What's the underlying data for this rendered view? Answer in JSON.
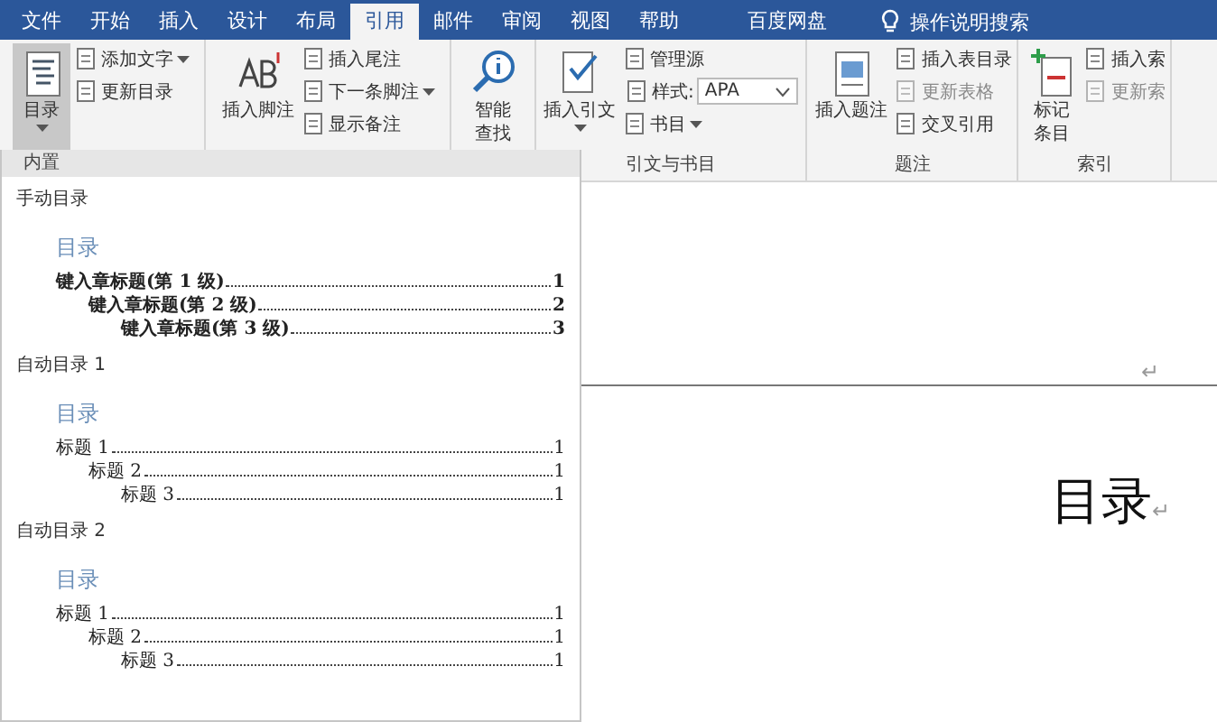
{
  "menu_tabs": [
    {
      "label": "文件",
      "selected": false
    },
    {
      "label": "开始",
      "selected": false
    },
    {
      "label": "插入",
      "selected": false
    },
    {
      "label": "设计",
      "selected": false
    },
    {
      "label": "布局",
      "selected": false
    },
    {
      "label": "引用",
      "selected": true
    },
    {
      "label": "邮件",
      "selected": false
    },
    {
      "label": "审阅",
      "selected": false
    },
    {
      "label": "视图",
      "selected": false
    },
    {
      "label": "帮助",
      "selected": false
    },
    {
      "label": "百度网盘",
      "selected": false
    }
  ],
  "tell_me": {
    "placeholder": "操作说明搜索"
  },
  "ribbon": {
    "groups": [
      {
        "large": [
          {
            "label": "目录",
            "dropdown": true,
            "pressed": true
          }
        ],
        "small": [
          {
            "kind": "button",
            "label": "添加文字",
            "dropdown": true,
            "disabled": false
          },
          {
            "kind": "button",
            "label": "更新目录",
            "dropdown": false,
            "disabled": false
          }
        ]
      },
      {
        "large": [
          {
            "label": "插入脚注",
            "dropdown": false,
            "pressed": false
          }
        ],
        "small": [
          {
            "kind": "button",
            "label": "插入尾注",
            "dropdown": false,
            "disabled": false
          },
          {
            "kind": "button",
            "label": "下一条脚注",
            "dropdown": true,
            "disabled": false
          },
          {
            "kind": "button",
            "label": "显示备注",
            "dropdown": false,
            "disabled": false
          }
        ]
      },
      {
        "large": [
          {
            "label": "智能查找",
            "dropdown": false,
            "pressed": false
          }
        ]
      },
      {
        "label": "引文与书目",
        "large": [
          {
            "label": "插入引文",
            "dropdown": true,
            "pressed": false
          }
        ],
        "small": [
          {
            "kind": "button",
            "label": "管理源",
            "dropdown": false,
            "disabled": false
          },
          {
            "kind": "select",
            "label": "样式:",
            "value": "APA"
          },
          {
            "kind": "button",
            "label": "书目",
            "dropdown": true,
            "disabled": false
          }
        ]
      },
      {
        "label": "题注",
        "large": [
          {
            "label": "插入题注",
            "dropdown": false,
            "pressed": false
          }
        ],
        "small": [
          {
            "kind": "button",
            "label": "插入表目录",
            "dropdown": false,
            "disabled": false
          },
          {
            "kind": "button",
            "label": "更新表格",
            "dropdown": false,
            "disabled": true
          },
          {
            "kind": "button",
            "label": "交叉引用",
            "dropdown": false,
            "disabled": false
          }
        ]
      },
      {
        "label": "索引",
        "large": [
          {
            "label": "标记条目",
            "dropdown": false,
            "pressed": false
          }
        ],
        "small": [
          {
            "kind": "button",
            "label": "插入索",
            "dropdown": false,
            "disabled": false
          },
          {
            "kind": "button",
            "label": "更新索",
            "dropdown": false,
            "disabled": true
          }
        ]
      }
    ]
  },
  "toc_gallery": {
    "header": "内置",
    "sections": [
      {
        "label": "手动目录",
        "title": "目录",
        "bold": true,
        "entries": [
          {
            "text": "键入章标题(第 1 级)",
            "page": "1",
            "children": [
              {
                "text": "键入章标题(第 2 级)",
                "page": "2",
                "children": [
                  {
                    "text": "键入章标题(第 3 级)",
                    "page": "3"
                  }
                ]
              }
            ]
          }
        ]
      },
      {
        "label": "自动目录 1",
        "title": "目录",
        "bold": false,
        "entries": [
          {
            "text": "标题 1",
            "page": "1",
            "children": [
              {
                "text": "标题 2",
                "page": "1",
                "children": [
                  {
                    "text": "标题 3",
                    "page": "1"
                  }
                ]
              }
            ]
          }
        ]
      },
      {
        "label": "自动目录 2",
        "title": "目录",
        "bold": false,
        "entries": [
          {
            "text": "标题 1",
            "page": "1",
            "children": [
              {
                "text": "标题 2",
                "page": "1",
                "children": [
                  {
                    "text": "标题 3",
                    "page": "1"
                  }
                ]
              }
            ]
          }
        ]
      }
    ]
  },
  "document": {
    "header_mark": "↵",
    "title": "目录",
    "title_mark": "↵"
  }
}
